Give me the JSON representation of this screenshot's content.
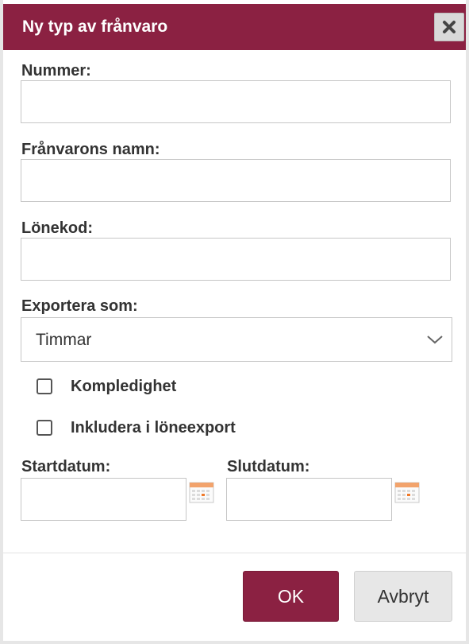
{
  "dialog": {
    "title": "Ny typ av frånvaro",
    "close_icon": "close-icon",
    "accent_color": "#8b2142"
  },
  "form": {
    "number": {
      "label": "Nummer:",
      "value": ""
    },
    "name": {
      "label": "Frånvarons namn:",
      "value": ""
    },
    "payroll_code": {
      "label": "Lönekod:",
      "value": ""
    },
    "export_as": {
      "label": "Exportera som:",
      "selected": "Timmar",
      "icon": "chevron-down-icon"
    },
    "checkboxes": [
      {
        "label": "Kompledighet",
        "checked": false
      },
      {
        "label": "Inkludera i löneexport",
        "checked": false
      }
    ],
    "start_date": {
      "label": "Startdatum:",
      "value": "",
      "icon": "calendar-icon"
    },
    "end_date": {
      "label": "Slutdatum:",
      "value": "",
      "icon": "calendar-icon"
    }
  },
  "buttons": {
    "ok": "OK",
    "cancel": "Avbryt"
  }
}
